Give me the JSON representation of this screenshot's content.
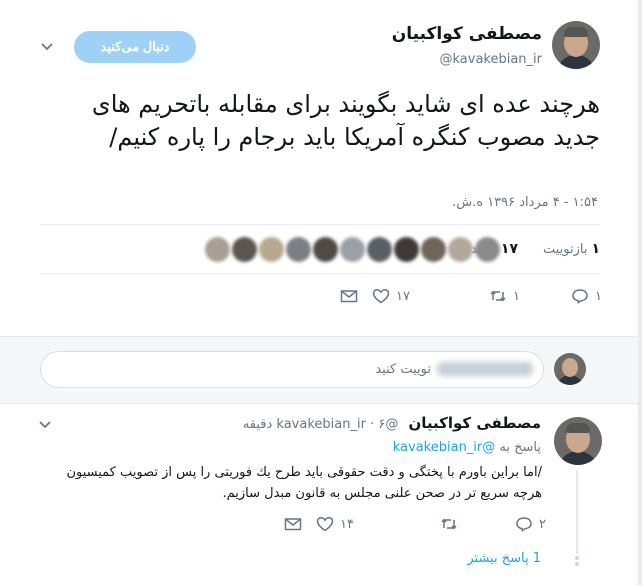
{
  "author": {
    "name": "مصطفی کواکبیان",
    "handle": "@kavakebian_ir"
  },
  "follow_button": {
    "label": "دنبال می‌کنید"
  },
  "tweet": {
    "text": "هرچند عده ای شاید بگویند برای مقابله باتحریم های جدید مصوب کنگره آمریکا باید برجام را پاره کنیم/",
    "timestamp": "۱:۵۴ - ۴ مرداد ۱۳۹۶ ه.ش."
  },
  "stats": {
    "retweets_count": "۱",
    "retweets_label": "بازتوییت",
    "likes_count": "۱۷",
    "likes_label": "پسند",
    "liker_colors": [
      "#8a8a8a",
      "#b3a89a",
      "#6f6558",
      "#3f3a36",
      "#5a5f66",
      "#9aa0a8",
      "#4f4a44",
      "#7a7f86",
      "#b8a890",
      "#5b5550",
      "#a89f92"
    ]
  },
  "actions": {
    "reply_count": "۱",
    "retweet_count": "۱",
    "like_count": "۱۷"
  },
  "reply_box": {
    "placeholder": "توییت کنید"
  },
  "reply": {
    "name": "مصطفی کواکبیان",
    "handle": "@kavakebian_ir",
    "time": "۶ دقیقه",
    "replying_to_prefix": "پاسخ به",
    "replying_to_handle": "@kavakebian_ir",
    "text": "/اما براین باورم با پختگی و دقت حقوقی باید طرح یك فوریتی را پس از تصویب كمیسیون هرچه سریع تر در صحن علنی مجلس به قانون مبدل سازیم.",
    "reply_count": "۲",
    "retweet_count": "",
    "like_count": "۱۴",
    "more_replies": "1 پاسخ بیشتر"
  },
  "colors": {
    "accent": "#1da1f2",
    "follow_button_bg": "#9fd0f5",
    "muted": "#657786"
  }
}
